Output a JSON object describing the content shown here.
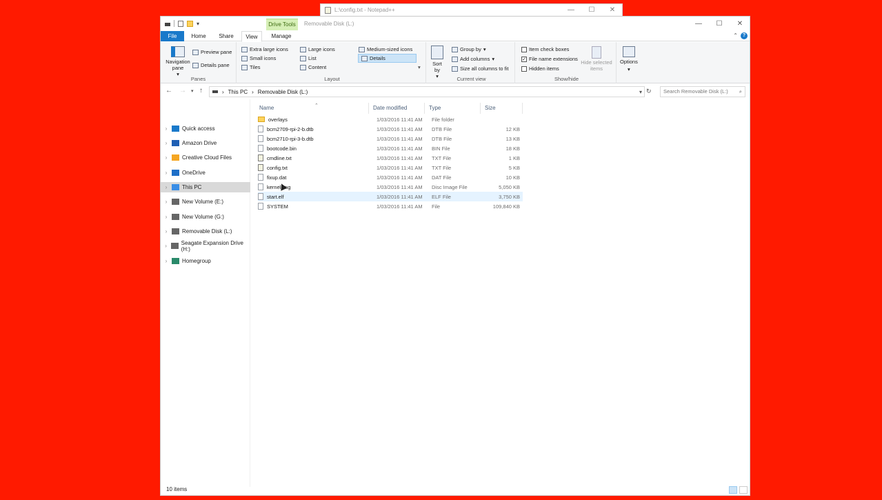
{
  "background_color": "#ff1a00",
  "notepad": {
    "title": "L:\\config.txt - Notepad++",
    "controls": [
      "—",
      "☐",
      "✕"
    ]
  },
  "explorer": {
    "qat_dropdown": "▾",
    "contextual_tab": "Drive Tools",
    "window_title": "Removable Disk (L:)",
    "controls": [
      "—",
      "☐",
      "✕"
    ],
    "tabs": [
      "File",
      "Home",
      "Share",
      "View",
      "Manage"
    ],
    "active_tab": "View",
    "help_label": "?",
    "ribbon": {
      "panes": {
        "label": "Panes",
        "navigation_pane": "Navigation pane",
        "navigation_pane_caret": "▾",
        "preview_pane": "Preview pane",
        "details_pane": "Details pane"
      },
      "layout": {
        "label": "Layout",
        "items": [
          "Extra large icons",
          "Large icons",
          "Medium-sized icons",
          "Small icons",
          "List",
          "Details",
          "Tiles",
          "Content"
        ],
        "selected": "Details",
        "expand": "▾"
      },
      "current_view": {
        "label": "Current view",
        "sort_by": "Sort by",
        "sort_by_caret": "▾",
        "group_by": "Group by",
        "add_columns": "Add columns",
        "dropdown_caret": "▾",
        "size_all_columns": "Size all columns to fit"
      },
      "show_hide": {
        "label": "Show/hide",
        "item_check_boxes": "Item check boxes",
        "file_name_extensions": "File name extensions",
        "hidden_items": "Hidden items",
        "file_name_extensions_checked": true,
        "hide_selected_items": "Hide selected items",
        "check_mark": "✓"
      },
      "options": {
        "label": "Options",
        "caret": "▾"
      }
    },
    "address": {
      "path": [
        "This PC",
        "Removable Disk (L:)"
      ],
      "separator": "›",
      "search_placeholder": "Search Removable Disk (L:)"
    },
    "nav_glyphs": {
      "back": "←",
      "forward": "→",
      "recent": "▾",
      "up": "↑",
      "expand": "›",
      "dropdown": "▾",
      "refresh": "↻",
      "search": "⌕",
      "sort_caret": "⌃"
    },
    "nav_pane": [
      {
        "label": "Quick access",
        "icon": "star-icon",
        "color": "#1979ca"
      },
      {
        "label": "Amazon Drive",
        "icon": "amazon-drive-icon",
        "color": "#1f5fb4"
      },
      {
        "label": "Creative Cloud Files",
        "icon": "creative-cloud-icon",
        "color": "#f5a623"
      },
      {
        "label": "OneDrive",
        "icon": "onedrive-icon",
        "color": "#1e6fc8"
      },
      {
        "label": "This PC",
        "icon": "computer-icon",
        "color": "#3a8ee6",
        "selected": true
      },
      {
        "label": "New Volume (E:)",
        "icon": "drive-icon",
        "color": "#666666"
      },
      {
        "label": "New Volume (G:)",
        "icon": "drive-icon",
        "color": "#666666"
      },
      {
        "label": "Removable Disk (L:)",
        "icon": "drive-icon",
        "color": "#666666"
      },
      {
        "label": "Seagate Expansion Drive (H:)",
        "icon": "drive-icon",
        "color": "#666666"
      },
      {
        "label": "Homegroup",
        "icon": "homegroup-icon",
        "color": "#2a8a6a"
      }
    ],
    "columns": [
      "Name",
      "Date modified",
      "Type",
      "Size"
    ],
    "files": [
      {
        "name": "overlays",
        "date": "1/03/2016 11:41 AM",
        "type": "File folder",
        "size": "",
        "icon": "folder-icon"
      },
      {
        "name": "bcm2709-rpi-2-b.dtb",
        "date": "1/03/2016 11:41 AM",
        "type": "DTB File",
        "size": "12 KB",
        "icon": "file-icon"
      },
      {
        "name": "bcm2710-rpi-3-b.dtb",
        "date": "1/03/2016 11:41 AM",
        "type": "DTB File",
        "size": "13 KB",
        "icon": "file-icon"
      },
      {
        "name": "bootcode.bin",
        "date": "1/03/2016 11:41 AM",
        "type": "BIN File",
        "size": "18 KB",
        "icon": "file-icon"
      },
      {
        "name": "cmdline.txt",
        "date": "1/03/2016 11:41 AM",
        "type": "TXT File",
        "size": "1 KB",
        "icon": "text-file-icon"
      },
      {
        "name": "config.txt",
        "date": "1/03/2016 11:41 AM",
        "type": "TXT File",
        "size": "5 KB",
        "icon": "text-file-icon"
      },
      {
        "name": "fixup.dat",
        "date": "1/03/2016 11:41 AM",
        "type": "DAT File",
        "size": "10 KB",
        "icon": "file-icon"
      },
      {
        "name": "kernel.img",
        "date": "1/03/2016 11:41 AM",
        "type": "Disc Image File",
        "size": "5,050 KB",
        "icon": "disc-image-icon"
      },
      {
        "name": "start.elf",
        "date": "1/03/2016 11:41 AM",
        "type": "ELF File",
        "size": "3,750 KB",
        "icon": "file-icon",
        "hover": true
      },
      {
        "name": "SYSTEM",
        "date": "1/03/2016 11:41 AM",
        "type": "File",
        "size": "109,840 KB",
        "icon": "file-icon"
      }
    ],
    "status": "10 items"
  }
}
